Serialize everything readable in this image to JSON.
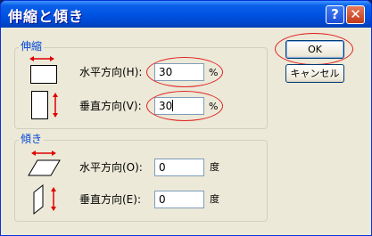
{
  "window": {
    "title": "伸縮と傾き"
  },
  "titlebar": {
    "help_glyph": "?",
    "close_glyph": "✕"
  },
  "stretch": {
    "group_label": "伸縮",
    "horizontal_label": "水平方向(H):",
    "horizontal_value": "30",
    "horizontal_unit": "%",
    "vertical_label": "垂直方向(V):",
    "vertical_value": "30",
    "vertical_unit": "%"
  },
  "skew": {
    "group_label": "傾き",
    "horizontal_label": "水平方向(O):",
    "horizontal_value": "0",
    "horizontal_unit": "度",
    "vertical_label": "垂直方向(E):",
    "vertical_value": "0",
    "vertical_unit": "度"
  },
  "buttons": {
    "ok_label": "OK",
    "cancel_label": "キャンセル"
  },
  "icons": {
    "stretch_horizontal": "stretch-horizontal-icon",
    "stretch_vertical": "stretch-vertical-icon",
    "skew_horizontal": "skew-horizontal-icon",
    "skew_vertical": "skew-vertical-icon"
  },
  "colors": {
    "titlebar": "#0054e3",
    "dialog_bg": "#ece9d8",
    "group_label": "#0046d5",
    "annotation_red": "#e02020",
    "arrow_red": "#e00000"
  }
}
